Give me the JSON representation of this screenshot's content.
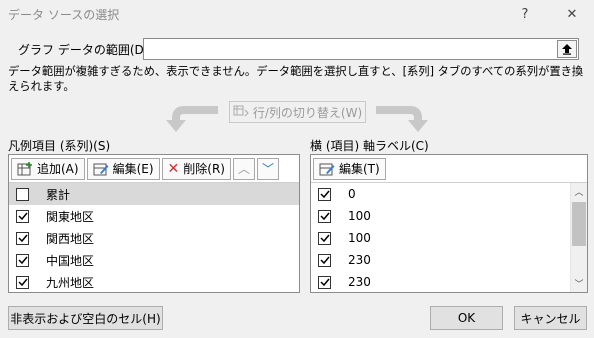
{
  "window": {
    "title": "データ ソースの選択",
    "help_glyph": "?",
    "close_glyph": "✕"
  },
  "range": {
    "label": "グラフ データの範囲(D):",
    "value": "",
    "collapse_icon": "collapse-range-icon"
  },
  "message": "データ範囲が複雑すぎるため、表示できません。データ範囲を選択し直すと、[系列] タブのすべての系列が置き換えられます。",
  "switch_button": {
    "label": "行/列の切り替え(W)",
    "enabled": false
  },
  "series_panel": {
    "label": "凡例項目 (系列)(S)",
    "add_label": "追加(A)",
    "edit_label": "編集(E)",
    "delete_label": "削除(R)",
    "items": [
      {
        "label": "累計",
        "checked": false
      },
      {
        "label": "関東地区",
        "checked": true
      },
      {
        "label": "関西地区",
        "checked": true
      },
      {
        "label": "中国地区",
        "checked": true
      },
      {
        "label": "九州地区",
        "checked": true
      }
    ]
  },
  "axis_panel": {
    "label": "横 (項目) 軸ラベル(C)",
    "edit_label": "編集(T)",
    "items": [
      {
        "label": "0",
        "checked": true
      },
      {
        "label": "100",
        "checked": true
      },
      {
        "label": "100",
        "checked": true
      },
      {
        "label": "230",
        "checked": true
      },
      {
        "label": "230",
        "checked": true
      }
    ]
  },
  "footer": {
    "hidden_cells_label": "非表示および空白のセル(H)",
    "ok_label": "OK",
    "cancel_label": "キャンセル"
  },
  "colors": {
    "dialog_bg": "#f0f0f0",
    "delete_icon": "#d32f2f",
    "accent": "#1a6fc0"
  }
}
